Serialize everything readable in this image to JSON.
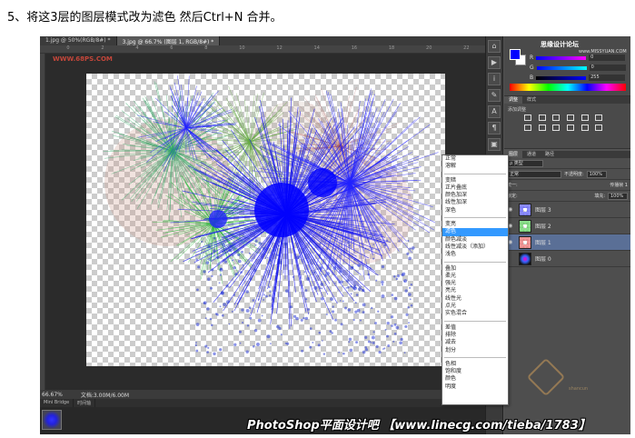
{
  "instruction": "5、将这3层的图层模式改为滤色 然后Ctrl+N 合并。",
  "tabs": [
    "1.jpg @ 50%(RGB/8#) *",
    "3.jpg @ 66.7% (图层 1, RGB/8#) *"
  ],
  "ruler_marks": [
    "0",
    "2",
    "4",
    "6",
    "8",
    "10",
    "12",
    "14",
    "16",
    "18",
    "20",
    "22"
  ],
  "watermark_left": "WWW.68PS.COM",
  "status": {
    "zoom": "66.67%",
    "doc": "文档:3.00M/6.00M"
  },
  "mini_tabs": [
    "Mini Bridge",
    "时间轴"
  ],
  "color_panel": {
    "title_watermark": "思缘设计论坛",
    "site": "www.MISSYUAN.COM",
    "rows": [
      {
        "label": "R",
        "value": "0"
      },
      {
        "label": "G",
        "value": "0"
      },
      {
        "label": "B",
        "value": "255"
      }
    ],
    "fg_color": "#0000ff"
  },
  "adjust_panel": {
    "tabs": [
      "调整",
      "样式"
    ],
    "title": "添加调整"
  },
  "layers_panel": {
    "tabs": [
      "图层",
      "通道",
      "路径"
    ],
    "filter": "ρ 类型",
    "mode": "正常",
    "opacity_label": "不透明度:",
    "opacity_value": "100%",
    "lock_label": "锁定:",
    "fill_label": "填充:",
    "fill_value": "100%",
    "propagate": "传播帧 1",
    "unify": "统一:",
    "layers": [
      {
        "name": "图层 3",
        "selected": false
      },
      {
        "name": "图层 2",
        "selected": false
      },
      {
        "name": "图层 1",
        "selected": true
      },
      {
        "name": "图层 0",
        "selected": false
      }
    ]
  },
  "blend_modes": [
    [
      "正常",
      "溶解"
    ],
    [
      "变暗",
      "正片叠底",
      "颜色加深",
      "线性加深",
      "深色"
    ],
    [
      "变亮",
      "滤色",
      "颜色减淡",
      "线性减淡（添加）",
      "浅色"
    ],
    [
      "叠加",
      "柔光",
      "强光",
      "亮光",
      "线性光",
      "点光",
      "实色混合"
    ],
    [
      "差值",
      "排除",
      "减去",
      "划分"
    ],
    [
      "色相",
      "饱和度",
      "颜色",
      "明度"
    ]
  ],
  "highlighted_mode": "滤色",
  "banner": "PhotoShop平面设计吧 【www.linecg.com/tieba/1783】",
  "badge_text": "shancun"
}
